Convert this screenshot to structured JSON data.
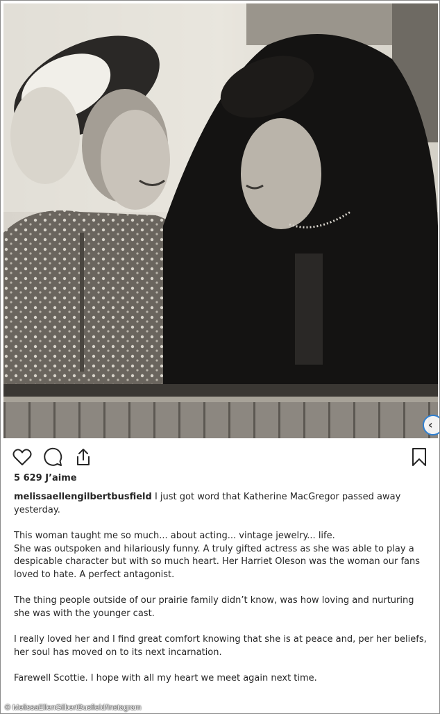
{
  "post": {
    "likes": "5 629 J’aime",
    "username": "melissaellengilbertbusfield",
    "caption_first": "I just got word that Katherine MacGregor passed away yesterday.",
    "paragraphs": [
      "This woman taught me so much... about acting... vintage jewelry... life.",
      "She was outspoken and hilariously funny. A truly gifted actress as she was able to play a despicable character but with so much heart. Her Harriet Oleson was the woman our fans loved to hate. A perfect antagonist.",
      "The thing people outside of our prairie family didn’t know, was how loving and nurturing she was with the younger cast.",
      "I really loved her and I find great comfort knowing that she is at peace and, per her beliefs, her soul has moved on to its next incarnation.",
      "Farewell Scottie. I hope with all my heart we meet again next time."
    ]
  },
  "icons": {
    "like": "heart-icon",
    "comment": "comment-icon",
    "share": "share-icon",
    "save": "bookmark-icon",
    "next": "chevron-left-icon"
  },
  "carousel_glyph": "‹",
  "watermark": "© MelissaEllenGilbertBusfield/Instagram",
  "colors": {
    "accent": "#2f7fd0",
    "text": "#262626"
  }
}
